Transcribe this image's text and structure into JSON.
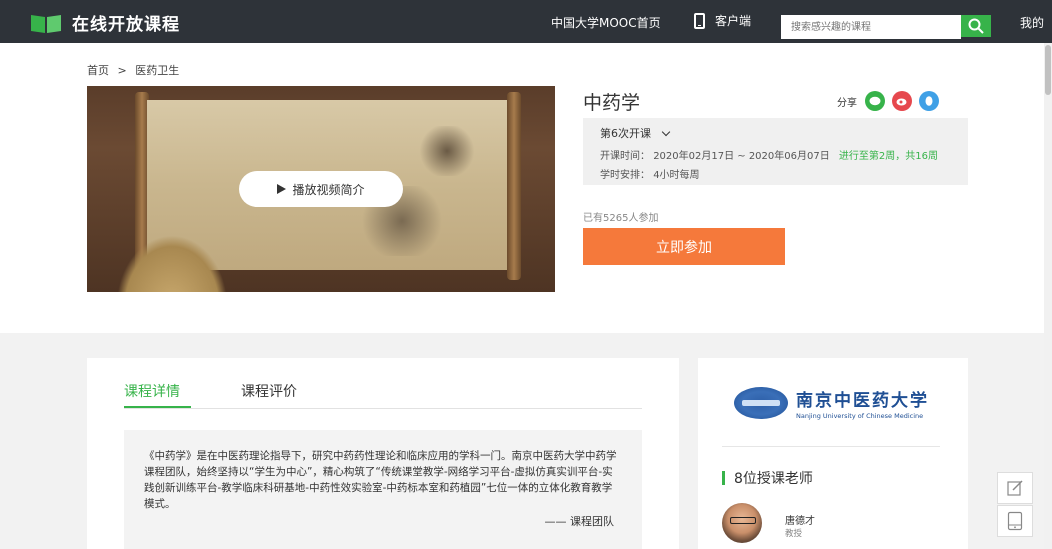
{
  "header": {
    "logo_text": "在线开放课程",
    "nav_mooc": "中国大学MOOC首页",
    "nav_client": "客户端",
    "search_placeholder": "搜索感兴趣的课程",
    "nav_my": "我的"
  },
  "breadcrumb": {
    "home": "首页",
    "separator": ">",
    "category": "医药卫生"
  },
  "video": {
    "play_label": "播放视频简介"
  },
  "course": {
    "title": "中药学",
    "share_label": "分享",
    "share_icons": [
      "wechat-icon",
      "weibo-icon",
      "qq-icon"
    ],
    "term_label": "第6次开课",
    "time_label": "开课时间：",
    "time_value": "2020年02月17日 ~ 2020年06月07日",
    "progress": "进行至第2周，共16周",
    "schedule_label": "学时安排：",
    "schedule_value": "4小时每周",
    "enrolled": "已有5265人参加",
    "join_label": "立即参加"
  },
  "tabs": {
    "detail": "课程详情",
    "review": "课程评价"
  },
  "intro": {
    "text": "《中药学》是在中医药理论指导下，研究中药药性理论和临床应用的学科一门。南京中医药大学中药学课程团队，始终坚持以“学生为中心”，精心构筑了“传统课堂教学-网络学习平台-虚拟仿真实训平台-实践创新训练平台-教学临床科研基地-中药性效实验室-中药标本室和药植园”七位一体的立体化教育教学模式。",
    "signature": "—— 课程团队"
  },
  "university": {
    "name_cn": "南京中医药大学",
    "name_en": "Nanjing University of Chinese Medicine"
  },
  "teachers": {
    "heading": "8位授课老师",
    "list": [
      {
        "name": "唐德才",
        "title": "教授"
      }
    ]
  },
  "colors": {
    "topbar": "#2e3339",
    "accent_green": "#37b34a",
    "join_orange": "#f5793b"
  }
}
